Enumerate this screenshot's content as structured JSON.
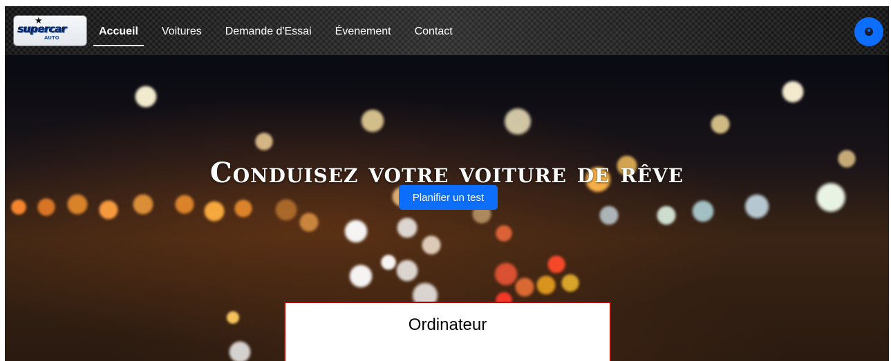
{
  "navbar": {
    "logo": {
      "word": "supercar",
      "sub": "AUTO"
    },
    "links": [
      {
        "label": "Accueil",
        "active": true
      },
      {
        "label": "Voitures",
        "active": false
      },
      {
        "label": "Demande d'Essai",
        "active": false
      },
      {
        "label": "Évenement",
        "active": false
      },
      {
        "label": "Contact",
        "active": false
      }
    ],
    "profile_icon": "user-circle-icon"
  },
  "hero": {
    "title": "Conduisez votre voiture de rêve",
    "button_label": "Planifier un test"
  },
  "caption": {
    "text": "Ordinateur"
  },
  "colors": {
    "primary": "#0d6efd",
    "caption_border": "#c00000",
    "nav_text": "#ffffff"
  }
}
